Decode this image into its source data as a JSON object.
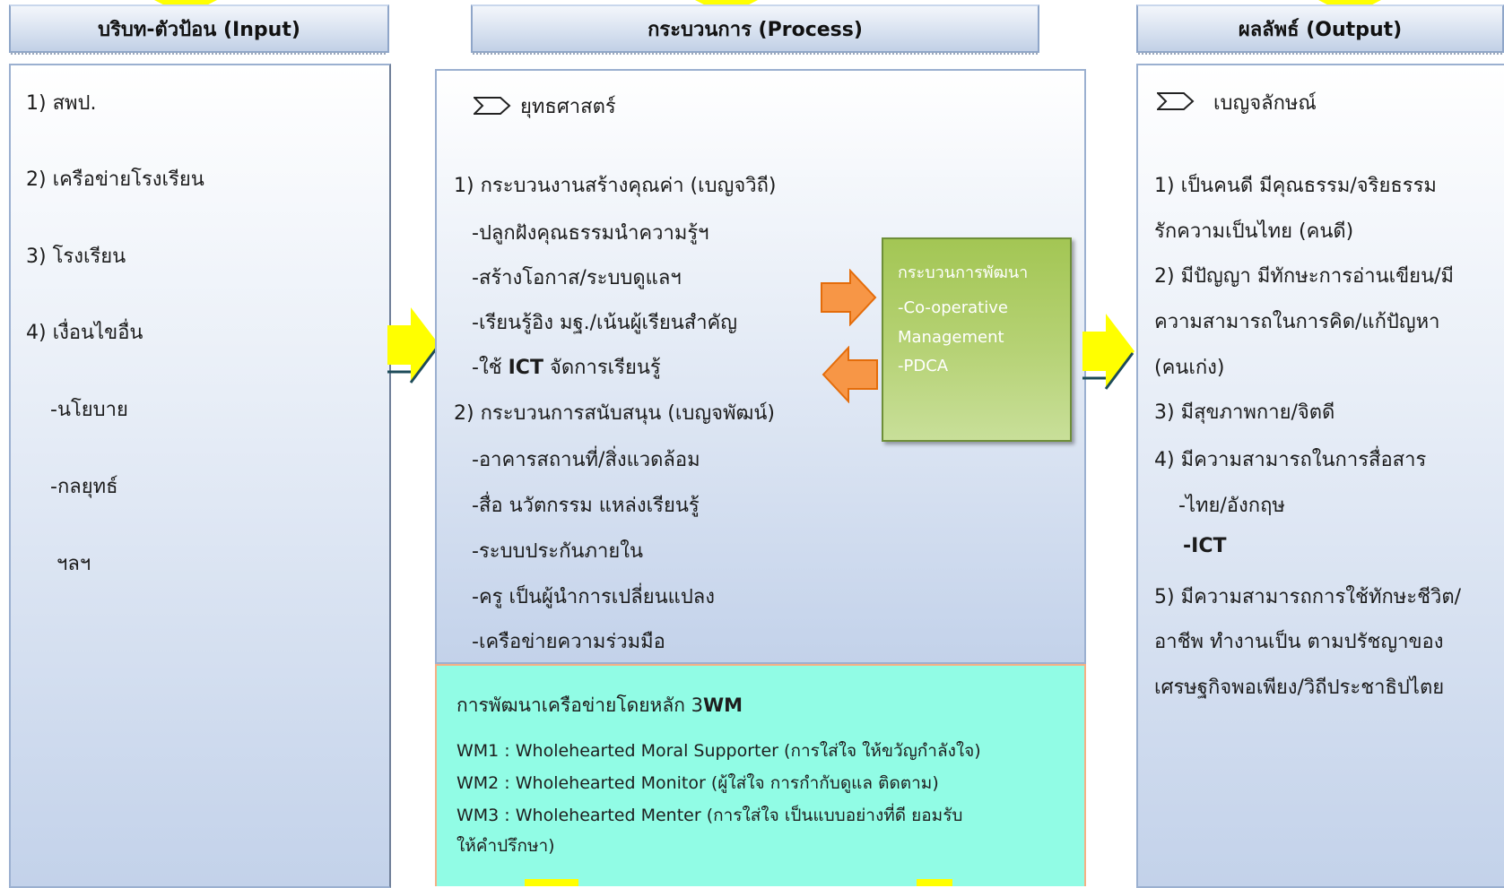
{
  "input": {
    "title": "บริบท-ตัวป้อน (Input)",
    "items": [
      "1) สพป.",
      "2) เครือข่ายโรงเรียน",
      "3) โรงเรียน",
      "4) เงื่อนไขอื่น",
      "-นโยบาย",
      "-กลยุทธ์",
      "ฯลฯ"
    ]
  },
  "process": {
    "title": "กระบวนการ (Process)",
    "strategy_label": "ยุทธศาสตร์",
    "group1_title": "1) กระบวนงานสร้างคุณค่า (เบญจวิถี)",
    "group1_items": [
      "-ปลูกฝังคุณธรรมนำความรู้ฯ",
      "-สร้างโอกาส/ระบบดูแลฯ",
      "-เรียนรู้อิง มฐ./เน้นผู้เรียนสำคัญ"
    ],
    "group1_ict_prefix": "-ใช้",
    "group1_ict_bold": "ICT",
    "group1_ict_suffix": "จัดการเรียนรู้",
    "group2_title": "2) กระบวนการสนับสนุน (เบญจพัฒน์)",
    "group2_items": [
      "-อาคารสถานที่/สิ่งแวดล้อม",
      "-สื่อ นวัตกรรม แหล่งเรียนรู้",
      "-ระบบประกันภายใน",
      "-ครู เป็นผู้นำการเปลี่ยนแปลง",
      "-เครือข่ายความร่วมมือ"
    ]
  },
  "development": {
    "title": "กระบวนการพัฒนา",
    "lines": [
      "-Co-operative",
      "Management",
      "-PDCA"
    ]
  },
  "network": {
    "title_prefix": "การพัฒนาเครือข่ายโดยหลัก 3",
    "title_bold": "WM",
    "lines": [
      "WM1 : Wholehearted Moral Supporter (การใส่ใจ ให้ขวัญกำลังใจ)",
      "WM2 : Wholehearted Monitor (ผู้ใส่ใจ การกำกับดูแล ติดตาม)",
      "WM3 : Wholehearted Menter  (การใส่ใจ เป็นแบบอย่างที่ดี ยอมรับ",
      "ให้คำปรึกษา)"
    ]
  },
  "output": {
    "title": "ผลลัพธ์ (Output)",
    "label": "เบญจลักษณ์",
    "lines": [
      "1) เป็นคนดี มีคุณธรรม/จริยธรรม",
      "รักความเป็นไทย (คนดี)",
      "2) มีปัญญา มีทักษะการอ่านเขียน/มี",
      "ความสามารถในการคิด/แก้ปัญหา",
      "(คนเก่ง)",
      "3) มีสุขภาพกาย/จิตดี",
      "4) มีความสามารถในการสื่อสาร",
      "-ไทย/อังกฤษ",
      "-ICT",
      "5) มีความสามารถการใช้ทักษะชีวิต/",
      "อาชีพ ทำงานเป็น ตามปรัชญาของ",
      "เศรษฐกิจพอเพียง/วิถีประชาธิปไตย"
    ]
  },
  "colors": {
    "arrow_yellow": "#ffff00",
    "arrow_orange": "#f79646",
    "dev_green": "#9bbb59",
    "network_cyan": "#91fce5"
  }
}
